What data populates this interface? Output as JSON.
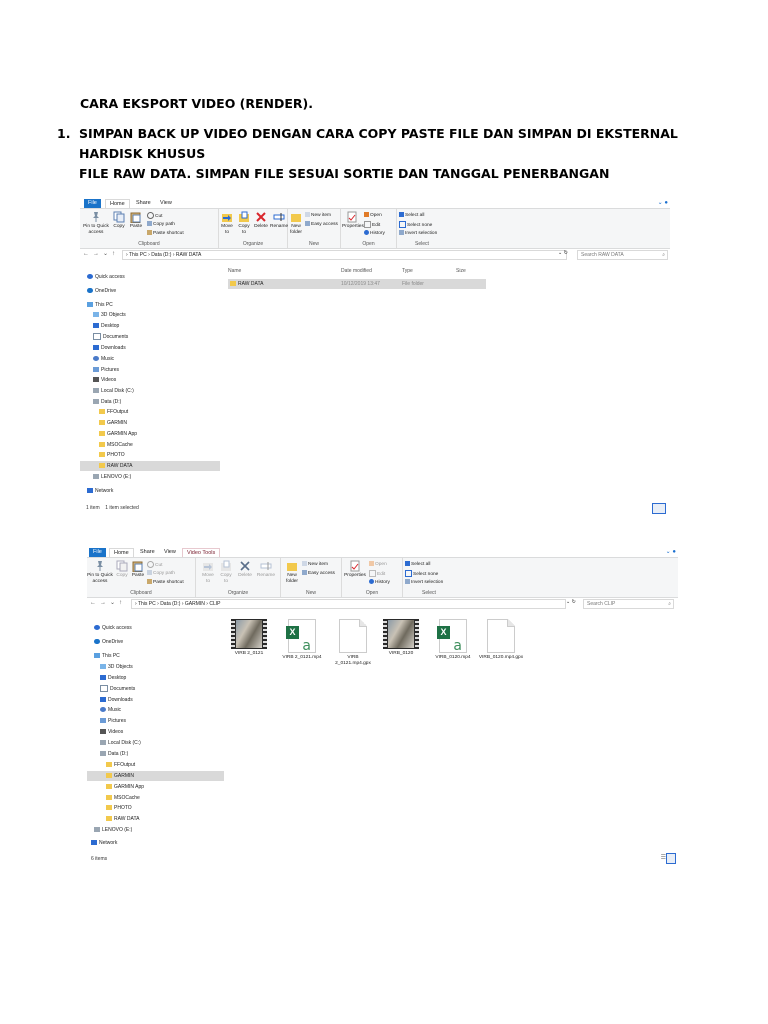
{
  "doc": {
    "heading": "CARA EKSPORT VIDEO (RENDER).",
    "step1_number": "1.",
    "step1_line1": "SIMPAN BACK UP VIDEO DENGAN CARA COPY PASTE FILE DAN SIMPAN DI EKSTERNAL HARDISK KHUSUS",
    "step1_line2": "FILE RAW DATA. SIMPAN FILE SESUAI SORTIE DAN TANGGAL PENERBANGAN"
  },
  "ribbon": {
    "tabs": {
      "file": "File",
      "home": "Home",
      "share": "Share",
      "view": "View",
      "video_tools": "Video Tools"
    },
    "pin": "Pin to Quick access",
    "copy": "Copy",
    "paste": "Paste",
    "cut": "Cut",
    "copy_path": "Copy path",
    "paste_shortcut": "Paste shortcut",
    "move_to": "Move to",
    "copy_to": "Copy to",
    "delete": "Delete",
    "rename": "Rename",
    "new_folder": "New folder",
    "new_item": "New item",
    "easy_access": "Easy access",
    "properties": "Properties",
    "open": "Open",
    "edit": "Edit",
    "history": "History",
    "select_all": "Select all",
    "select_none": "Select none",
    "invert_selection": "Invert selection",
    "groups": {
      "clipboard": "Clipboard",
      "organize": "Organize",
      "new": "New",
      "open": "Open",
      "select": "Select"
    }
  },
  "nav": {
    "quick_access": "Quick access",
    "onedrive": "OneDrive",
    "this_pc": "This PC",
    "objects3d": "3D Objects",
    "desktop": "Desktop",
    "documents": "Documents",
    "downloads": "Downloads",
    "music": "Music",
    "pictures": "Pictures",
    "videos": "Videos",
    "local_disk": "Local Disk (C:)",
    "data_d": "Data (D:)",
    "ffoutput": "FFOutput",
    "garmin": "GARMIN",
    "garmin_app": "GARMIN App",
    "msocache": "MSOCache",
    "photo": "PHOTO",
    "raw_data": "RAW DATA",
    "lenovo": "LENOVO (E:)",
    "network": "Network"
  },
  "window1": {
    "path": "›  This PC  ›  Data (D:)  ›  RAW DATA",
    "search_placeholder": "Search RAW DATA",
    "columns": {
      "name": "Name",
      "date": "Date modified",
      "type": "Type",
      "size": "Size"
    },
    "row": {
      "name": "RAW DATA",
      "date": "10/12/2019 13:47",
      "type": "File folder",
      "size": ""
    },
    "status_items": "1 item",
    "status_selected": "1 item selected"
  },
  "window2": {
    "path": "›  This PC  ›  Data (D:)  ›  GARMIN  ›  CLIP",
    "search_placeholder": "Search CLIP",
    "files": [
      {
        "label": "VIRB 2_0121"
      },
      {
        "label": "VIRB 2_0121.mp4"
      },
      {
        "label": "VIRB 2_0121.mp4.gpx"
      },
      {
        "label": "VIRB_0120"
      },
      {
        "label": "VIRB_0120.mp4"
      },
      {
        "label": "VIRB_0120.mp4.gpx"
      }
    ],
    "status_items": "6 items"
  }
}
